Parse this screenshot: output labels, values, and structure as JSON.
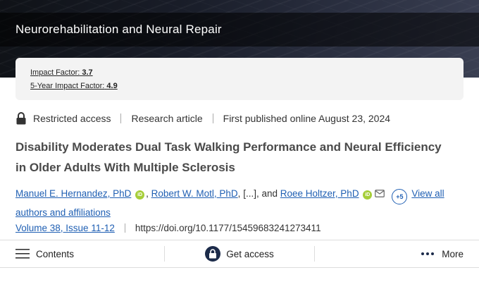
{
  "header": {
    "journal_title": "Neurorehabilitation and Neural Repair"
  },
  "impact": {
    "impact_factor_label": "Impact Factor:",
    "impact_factor_value": "3.7",
    "five_year_label": "5-Year Impact Factor:",
    "five_year_value": "4.9"
  },
  "meta": {
    "access": "Restricted access",
    "type": "Research article",
    "published": "First published online August 23, 2024"
  },
  "article": {
    "title": "Disability Moderates Dual Task Walking Performance and Neural Efficiency in Older Adults With Multiple Sclerosis"
  },
  "authors": {
    "author1": "Manuel E. Hernandez, PhD",
    "author2": "Robert W. Motl, PhD",
    "ellipsis": "[...]",
    "and": "and",
    "author3": "Roee Holtzer, PhD",
    "orcid_label": "iD",
    "more_count": "+5",
    "view_all": "View all authors and affiliations"
  },
  "citation": {
    "volume": "Volume 38, Issue 11-12",
    "doi": "https://doi.org/10.1177/15459683241273411"
  },
  "toolbar": {
    "contents": "Contents",
    "get_access": "Get access",
    "more": "More"
  },
  "colors": {
    "link": "#1f5fb3",
    "orcid": "#a6ce39",
    "access_icon_bg": "#1c2b4a"
  },
  "icons": [
    "lock-icon",
    "orcid-icon",
    "mail-icon",
    "menu-icon",
    "lock-circle-icon",
    "more-dots-icon"
  ]
}
